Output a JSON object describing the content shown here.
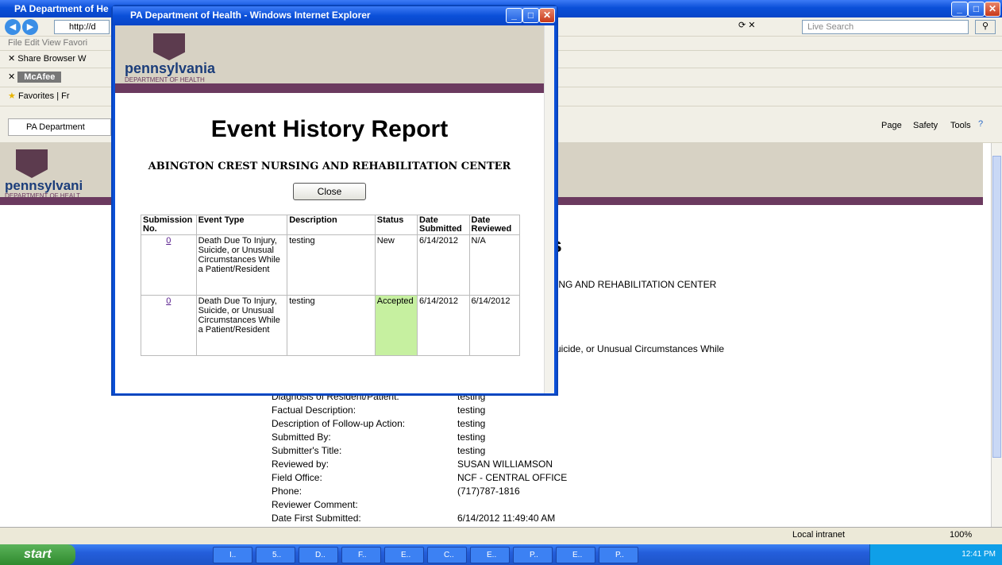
{
  "main_window": {
    "title": "PA Department of He",
    "address": "http://d",
    "live_search": "Live Search",
    "menu": "File  Edit  View  Favori",
    "links_row": "Share Browser  W",
    "mcafee": "McAfee",
    "favorites": "Favorites",
    "fav_tab": "Fr",
    "tab": "PA Department",
    "commands": [
      "Page",
      "Safety",
      "Tools"
    ],
    "logo_top": "pennsylvani",
    "logo_bottom": "DEPARTMENT OF HEALT",
    "heading_fragment": "ls",
    "facility_fragment": "SING AND REHABILITATION CENTER",
    "event_fragment": "Suicide, or Unusual Circumstances While",
    "details": [
      {
        "label": "Diagnosis of Resident/Patient:",
        "value": "testing"
      },
      {
        "label": "Factual Description:",
        "value": "testing"
      },
      {
        "label": "Description of Follow-up Action:",
        "value": "testing"
      },
      {
        "label": "Submitted By:",
        "value": "testing"
      },
      {
        "label": "Submitter's Title:",
        "value": "testing"
      },
      {
        "label": "Reviewed by:",
        "value": "SUSAN WILLIAMSON"
      },
      {
        "label": "Field Office:",
        "value": "NCF - CENTRAL OFFICE"
      },
      {
        "label": "Phone:",
        "value": "(717)787-1816"
      },
      {
        "label": "Reviewer Comment:",
        "value": ""
      },
      {
        "label": "Date First Submitted:",
        "value": "6/14/2012 11:49:40 AM"
      }
    ],
    "status_zone": "Local intranet",
    "zoom": "100%"
  },
  "popup": {
    "title": "PA Department of Health - Windows Internet Explorer",
    "logo_top": "pennsylvania",
    "logo_bottom": "DEPARTMENT OF HEALTH",
    "heading": "Event History Report",
    "facility": "ABINGTON CREST NURSING AND REHABILITATION CENTER",
    "close_label": "Close",
    "headers": [
      "Submission No.",
      "Event Type",
      "Description",
      "Status",
      "Date Submitted",
      "Date Reviewed"
    ],
    "rows": [
      {
        "no": "0",
        "event": "Death Due To Injury, Suicide, or Unusual Circumstances While a Patient/Resident",
        "desc": "testing",
        "status": "New",
        "submitted": "6/14/2012",
        "reviewed": "N/A"
      },
      {
        "no": "0",
        "event": "Death Due To Injury, Suicide, or Unusual Circumstances While a Patient/Resident",
        "desc": "testing",
        "status": "Accepted",
        "submitted": "6/14/2012",
        "reviewed": "6/14/2012"
      }
    ],
    "accepted_color": "#c6f0a0"
  },
  "taskbar": {
    "start": "start",
    "tasks": [
      "I..",
      "5..",
      "D..",
      "F..",
      "E..",
      "C..",
      "E..",
      "P..",
      "E..",
      "P.."
    ],
    "clock": "12:41 PM"
  }
}
